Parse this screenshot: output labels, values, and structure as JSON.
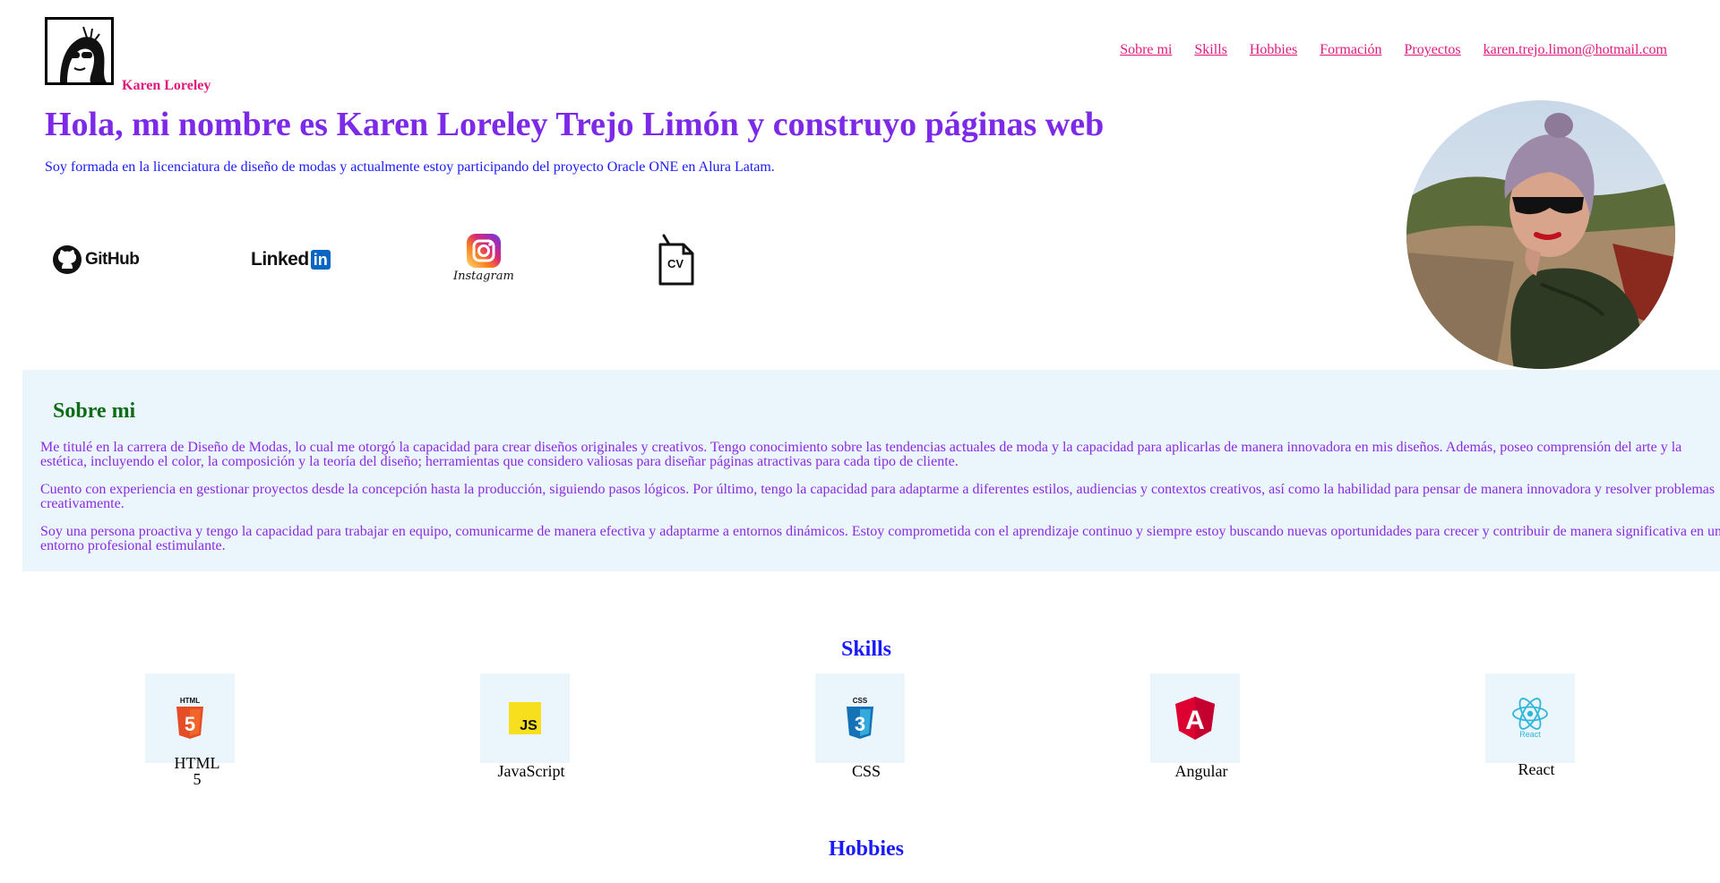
{
  "brand": {
    "name": "Karen Loreley"
  },
  "nav": {
    "items": [
      "Sobre mi",
      "Skills",
      "Hobbies",
      "Formación",
      "Proyectos",
      "karen.trejo.limon@hotmail.com"
    ]
  },
  "hero": {
    "title": "Hola, mi nombre es Karen Loreley Trejo Limón y construyo páginas web",
    "subtitle": "Soy formada en la licenciatura de diseño de modas y actualmente estoy participando del proyecto Oracle ONE en Alura Latam."
  },
  "social": {
    "github": "GitHub",
    "linkedin_text": "Linked",
    "linkedin_in": "in",
    "instagram": "Instagram",
    "cv": "CV"
  },
  "about": {
    "title": "Sobre mi",
    "paragraphs": [
      "Me titulé en la carrera de Diseño de Modas, lo cual me otorgó la capacidad para crear diseños originales y creativos. Tengo conocimiento sobre las tendencias actuales de moda y la capacidad para aplicarlas de manera innovadora en mis diseños. Además, poseo comprensión del arte y la estética, incluyendo el color, la composición y la teoría del diseño; herramientas que considero valiosas para diseñar páginas atractivas para cada tipo de cliente.",
      "Cuento con experiencia en gestionar proyectos desde la concepción hasta la producción, siguiendo pasos lógicos. Por último, tengo la capacidad para adaptarme a diferentes estilos, audiencias y contextos creativos, así como la habilidad para pensar de manera innovadora y resolver problemas creativamente.",
      "Soy una persona proactiva y tengo la capacidad para trabajar en equipo, comunicarme de manera efectiva y adaptarme a entornos dinámicos. Estoy comprometida con el aprendizaje continuo y siempre estoy buscando nuevas oportunidades para crecer y contribuir de manera significativa en un entorno profesional estimulante."
    ]
  },
  "skills": {
    "title": "Skills",
    "items": [
      {
        "name": "HTML 5",
        "icon": "html5-icon",
        "badge": "HTML",
        "glyph": "5"
      },
      {
        "name": "JavaScript",
        "icon": "javascript-icon",
        "badge": "JS"
      },
      {
        "name": "CSS",
        "icon": "css3-icon",
        "badge": "CSS",
        "glyph": "3"
      },
      {
        "name": "Angular",
        "icon": "angular-icon",
        "glyph": "A"
      },
      {
        "name": "React",
        "icon": "react-icon",
        "badge": "React"
      }
    ]
  },
  "hobbies": {
    "title": "Hobbies"
  },
  "colors": {
    "accent_pink": "#e0197d",
    "title_purple": "#7d2ae8",
    "link_blue": "#1a1aff",
    "about_green": "#0e6b16",
    "panel_bg": "#eaf5fc"
  }
}
